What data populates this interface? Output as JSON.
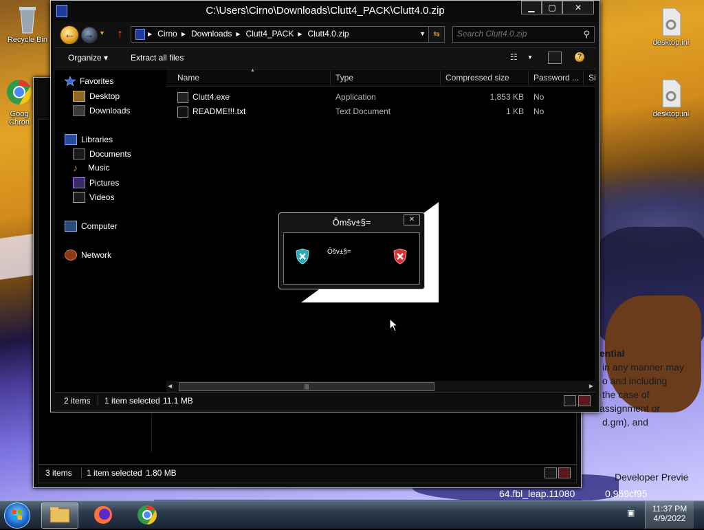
{
  "desktop": {
    "icons": [
      {
        "label": "Recycle Bin"
      },
      {
        "label": "Goog\nChron"
      },
      {
        "label": "desktop.ini"
      },
      {
        "label": "desktop.ini"
      }
    ],
    "wallpaper_text": {
      "line1": "ential",
      "line2": "in any manner may",
      "line3": "o and including",
      "line4": "the case of",
      "line5": "assignment or",
      "line6": "d.gm), and",
      "line7": "Developer Previe",
      "line8": "64.fbl_leap.11080",
      "line9": "0.959cf95"
    }
  },
  "back_window": {
    "status": {
      "items": "3 items",
      "selected": "1 item selected",
      "size": "1.80 MB"
    }
  },
  "window": {
    "title": "C:\\Users\\Cirno\\Downloads\\Clutt4_PACK\\Clutt4.0.zip",
    "address": {
      "crumbs": [
        "Cirno",
        "Downloads",
        "Clutt4_PACK",
        "Clutt4.0.zip"
      ]
    },
    "search": {
      "placeholder": "Search Clutt4.0.zip"
    },
    "commands": {
      "organize": "Organize ▾",
      "extract": "Extract all files"
    },
    "nav": {
      "favorites": "Favorites",
      "desktop": "Desktop",
      "downloads": "Downloads",
      "libraries": "Libraries",
      "documents": "Documents",
      "music": "Music",
      "pictures": "Pictures",
      "videos": "Videos",
      "computer": "Computer",
      "network": "Network"
    },
    "columns": {
      "name": "Name",
      "type": "Type",
      "compressed": "Compressed size",
      "password": "Password ...",
      "size": "Si"
    },
    "files": [
      {
        "name": "Clutt4.exe",
        "type": "Application",
        "compressed": "1,853 KB",
        "password": "No"
      },
      {
        "name": "README!!!.txt",
        "type": "Text Document",
        "compressed": "1 KB",
        "password": "No"
      }
    ],
    "status": {
      "items": "2 items",
      "selected": "1 item selected",
      "size": "11.1 MB"
    }
  },
  "dialog": {
    "title": "Ômšv±§=",
    "message": "Ôšv±§=",
    "close": "✕"
  },
  "taskbar": {
    "time": "11:37 PM",
    "date": "4/9/2022"
  },
  "colors": {
    "accent_orange": "#e2a324",
    "window_bg": "#101010",
    "taskbar": "#2c3a4c"
  }
}
